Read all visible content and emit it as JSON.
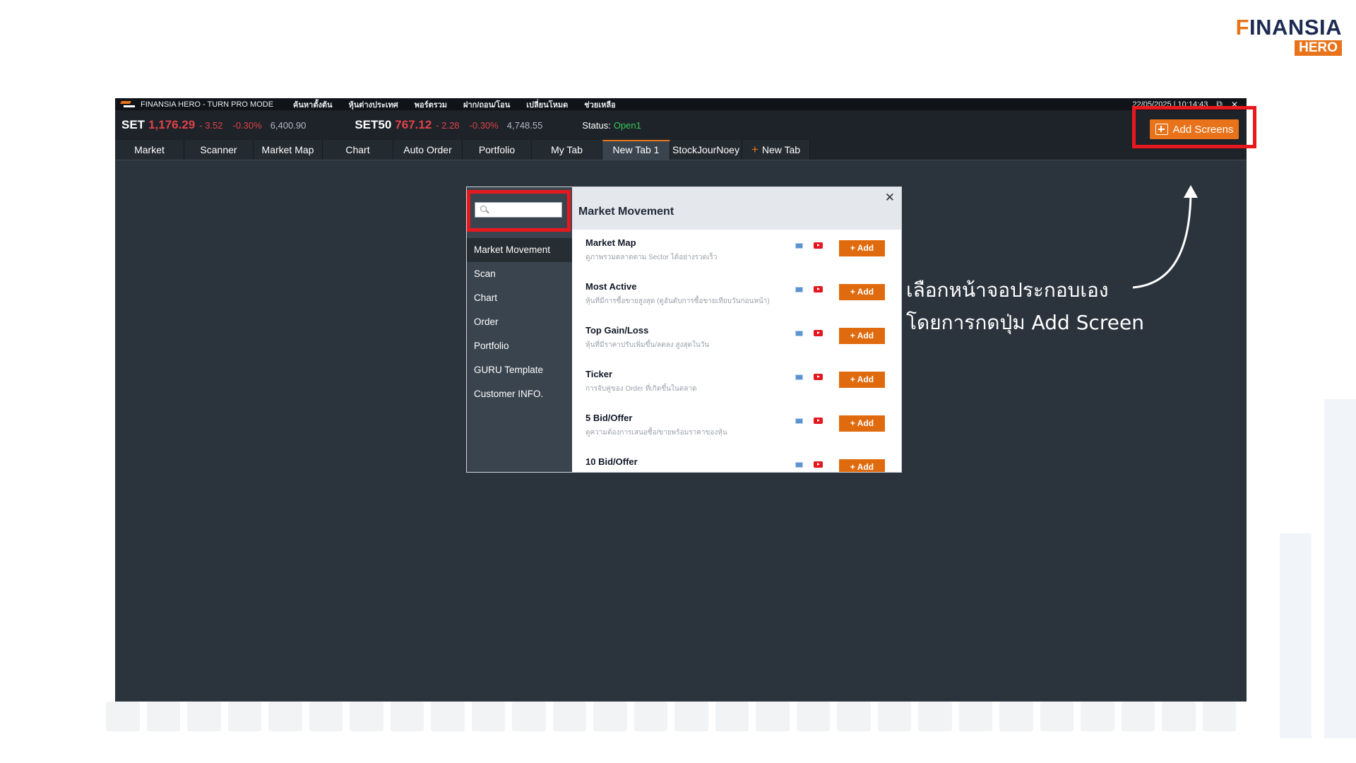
{
  "brand": {
    "word_first": "F",
    "word_rest": "INANSIA",
    "sub": "HERO"
  },
  "titlebar": {
    "title": "FINANSIA  HERO - TURN PRO MODE",
    "menu": [
      "ค้นหาตั้งต้น",
      "หุ้นต่างประเทศ",
      "พอร์ตรวม",
      "ฝาก/ถอน/โอน",
      "เปลี่ยนโหมด",
      "ช่วยเหลือ"
    ],
    "clock": "22/05/2025 | 10:14:43",
    "restore_glyph": "⧉",
    "close_glyph": "✕"
  },
  "quote": {
    "set": {
      "name": "SET",
      "price": "1,176.29",
      "change": "- 3.52",
      "pct": "-0.30%",
      "volume": "6,400.90"
    },
    "set50": {
      "name": "SET50",
      "price": "767.12",
      "change": "- 2.28",
      "pct": "-0.30%",
      "volume": "4,748.55"
    },
    "status_label": "Status:",
    "status_value": "Open1"
  },
  "tabs": [
    "Market",
    "Scanner",
    "Market Map",
    "Chart",
    "Auto Order",
    "Portfolio",
    "My Tab",
    "New Tab 1",
    "StockJourNoey"
  ],
  "new_tab_label": "New Tab",
  "add_screens_label": "Add Screens",
  "modal": {
    "search_placeholder": "",
    "categories": [
      "Market Movement",
      "Scan",
      "Chart",
      "Order",
      "Portfolio",
      "GURU Template",
      "Customer INFO."
    ],
    "active_category": "Market Movement",
    "header": "Market Movement",
    "close_glyph": "✕",
    "add_label": "+ Add",
    "items": [
      {
        "name": "Market Map",
        "desc": "ดูภาพรวมตลาดตาม Sector ได้อย่างรวดเร็ว"
      },
      {
        "name": "Most Active",
        "desc": "หุ้นที่มีการซื้อขายสูงสุด (ดูอันดับการซื้อขายเทียบวันก่อนหน้า)"
      },
      {
        "name": "Top Gain/Loss",
        "desc": "หุ้นที่มีราคาปรับเพิ่มขึ้น/ลดลง สูงสุดในวัน"
      },
      {
        "name": "Ticker",
        "desc": "การจับคู่ของ Order ที่เกิดขึ้นในตลาด"
      },
      {
        "name": "5 Bid/Offer",
        "desc": "ดูความต้องการเสนอซื้อ/ขายพร้อมราคาของหุ้น"
      },
      {
        "name": "10 Bid/Offer",
        "desc": ""
      }
    ]
  },
  "annotation": {
    "line1": "เลือกหน้าจอประกอบเอง",
    "line2": "โดยการกดปุ่ม Add Screen"
  },
  "colors": {
    "accent": "#e8731a",
    "highlight": "#e8191e",
    "app_bg": "#2b343d"
  }
}
